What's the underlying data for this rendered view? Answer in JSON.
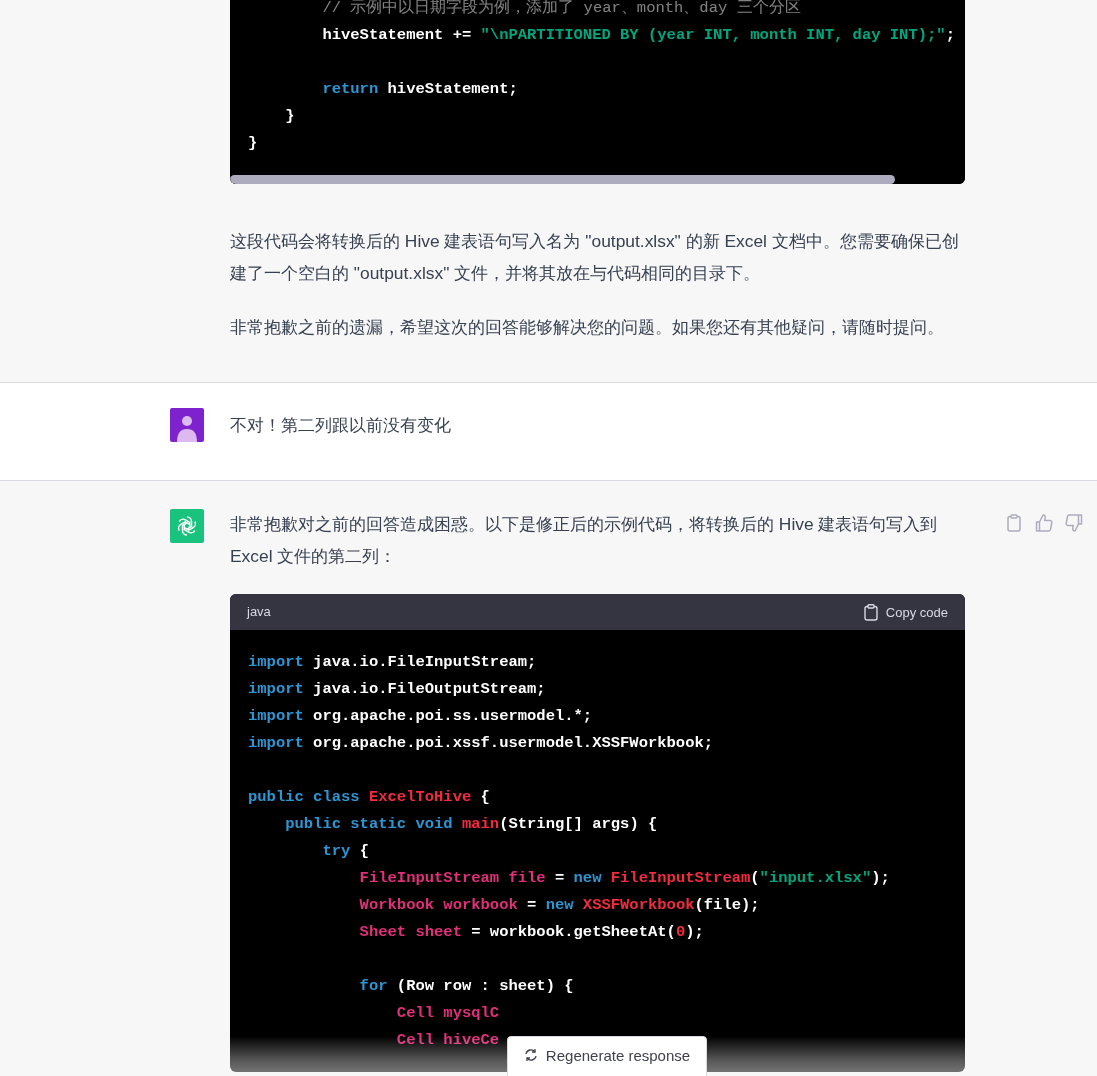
{
  "messages": [
    {
      "kind": "assistant",
      "blocks": [
        {
          "kind": "code",
          "scrolled": true,
          "lines": [
            {
              "kind": "code",
              "tokens": [
                {
                  "kind": "comment",
                  "text": "        // 示例中以日期字段为例，添加了 year、month、day 三个分区"
                }
              ]
            },
            {
              "kind": "code",
              "tokens": [
                {
                  "kind": "plain",
                  "text": "        hiveStatement += "
                },
                {
                  "kind": "string",
                  "text": "\"\\nPARTITIONED BY (year INT, month INT, day INT);\""
                },
                {
                  "kind": "plain",
                  "text": ";"
                }
              ]
            },
            {
              "kind": "blank"
            },
            {
              "kind": "code",
              "tokens": [
                {
                  "kind": "keyword",
                  "text": "        return"
                },
                {
                  "kind": "plain",
                  "text": " hiveStatement;"
                }
              ]
            },
            {
              "kind": "code",
              "tokens": [
                {
                  "kind": "plain",
                  "text": "    }"
                }
              ]
            },
            {
              "kind": "code",
              "tokens": [
                {
                  "kind": "plain",
                  "text": "}"
                }
              ]
            }
          ]
        },
        {
          "kind": "paragraph",
          "text": "这段代码会将转换后的 Hive 建表语句写入名为 \"output.xlsx\" 的新 Excel 文档中。您需要确保已创建了一个空白的 \"output.xlsx\" 文件，并将其放在与代码相同的目录下。"
        },
        {
          "kind": "paragraph",
          "text": "非常抱歉之前的遗漏，希望这次的回答能够解决您的问题。如果您还有其他疑问，请随时提问。"
        }
      ]
    },
    {
      "kind": "user",
      "avatar": true,
      "blocks": [
        {
          "kind": "paragraph",
          "text": "不对！第二列跟以前没有变化"
        }
      ]
    },
    {
      "kind": "assistant",
      "avatar": true,
      "actions": true,
      "blocks": [
        {
          "kind": "paragraph",
          "text": "非常抱歉对之前的回答造成困惑。以下是修正后的示例代码，将转换后的 Hive 建表语句写入到 Excel 文件的第二列："
        },
        {
          "kind": "code",
          "language": "java",
          "copy_label": "Copy code",
          "lines": [
            {
              "kind": "code",
              "tokens": [
                {
                  "kind": "keyword",
                  "text": "import"
                },
                {
                  "kind": "plain",
                  "text": " java.io.FileInputStream;"
                }
              ]
            },
            {
              "kind": "code",
              "tokens": [
                {
                  "kind": "keyword",
                  "text": "import"
                },
                {
                  "kind": "plain",
                  "text": " java.io.FileOutputStream;"
                }
              ]
            },
            {
              "kind": "code",
              "tokens": [
                {
                  "kind": "keyword",
                  "text": "import"
                },
                {
                  "kind": "plain",
                  "text": " org.apache.poi.ss.usermodel.*;"
                }
              ]
            },
            {
              "kind": "code",
              "tokens": [
                {
                  "kind": "keyword",
                  "text": "import"
                },
                {
                  "kind": "plain",
                  "text": " org.apache.poi.xssf.usermodel.XSSFWorkbook;"
                }
              ]
            },
            {
              "kind": "blank"
            },
            {
              "kind": "code",
              "tokens": [
                {
                  "kind": "keyword",
                  "text": "public class"
                },
                {
                  "kind": "title",
                  "text": " ExcelToHive"
                },
                {
                  "kind": "plain",
                  "text": " {"
                }
              ]
            },
            {
              "kind": "code",
              "tokens": [
                {
                  "kind": "keyword",
                  "text": "    public static void"
                },
                {
                  "kind": "title",
                  "text": " main"
                },
                {
                  "kind": "plain",
                  "text": "(String[] args) {"
                }
              ]
            },
            {
              "kind": "code",
              "tokens": [
                {
                  "kind": "keyword",
                  "text": "        try"
                },
                {
                  "kind": "plain",
                  "text": " {"
                }
              ]
            },
            {
              "kind": "code",
              "tokens": [
                {
                  "kind": "type",
                  "text": "            FileInputStream file"
                },
                {
                  "kind": "plain",
                  "text": " = "
                },
                {
                  "kind": "keyword",
                  "text": "new"
                },
                {
                  "kind": "title",
                  "text": " FileInputStream"
                },
                {
                  "kind": "plain",
                  "text": "("
                },
                {
                  "kind": "string",
                  "text": "\"input.xlsx\""
                },
                {
                  "kind": "plain",
                  "text": ");"
                }
              ]
            },
            {
              "kind": "code",
              "tokens": [
                {
                  "kind": "type",
                  "text": "            Workbook workbook"
                },
                {
                  "kind": "plain",
                  "text": " = "
                },
                {
                  "kind": "keyword",
                  "text": "new"
                },
                {
                  "kind": "title",
                  "text": " XSSFWorkbook"
                },
                {
                  "kind": "plain",
                  "text": "(file);"
                }
              ]
            },
            {
              "kind": "code",
              "tokens": [
                {
                  "kind": "type",
                  "text": "            Sheet sheet"
                },
                {
                  "kind": "plain",
                  "text": " = workbook.getSheetAt("
                },
                {
                  "kind": "title",
                  "text": "0"
                },
                {
                  "kind": "plain",
                  "text": ");"
                }
              ]
            },
            {
              "kind": "blank"
            },
            {
              "kind": "code",
              "tokens": [
                {
                  "kind": "keyword",
                  "text": "            for"
                },
                {
                  "kind": "plain",
                  "text": " (Row row : sheet) {"
                }
              ]
            },
            {
              "kind": "code",
              "tokens": [
                {
                  "kind": "type",
                  "text": "                Cell mysqlC"
                }
              ]
            },
            {
              "kind": "code",
              "tokens": [
                {
                  "kind": "type",
                  "text": "                Cell hiveCe"
                }
              ]
            }
          ]
        }
      ]
    }
  ],
  "regenerate_label": "Regenerate response"
}
